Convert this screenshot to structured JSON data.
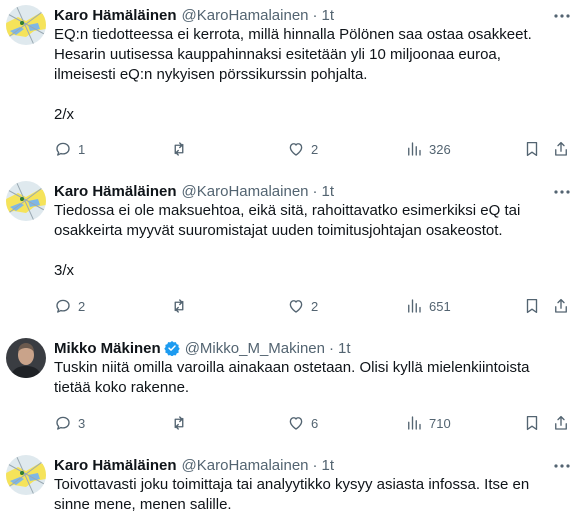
{
  "tweets": [
    {
      "name": "Karo Hämäläinen",
      "handle": "@KaroHamalainen",
      "time": "1t",
      "verified": false,
      "avatar": "map-avatar",
      "lines": [
        "EQ:n tiedotteessa ei kerrota, millä hinnalla Pölönen saa ostaa osakkeet.",
        "Hesarin uutisessa kauppahinnaksi esitetään yli 10 miljoonaa euroa,",
        "ilmeisesti eQ:n nykyisen pörssikurssin pohjalta."
      ],
      "footer": "2/x",
      "replies": "1",
      "retweets": "",
      "likes": "2",
      "views": "326"
    },
    {
      "name": "Karo Hämäläinen",
      "handle": "@KaroHamalainen",
      "time": "1t",
      "verified": false,
      "avatar": "map-avatar",
      "lines": [
        "Tiedossa ei ole maksuehtoa, eikä sitä, rahoittavatko esimerkiksi eQ tai",
        "osakkeirta myyvät suuromistajat uuden toimitusjohtajan osakeostot."
      ],
      "footer": "3/x",
      "replies": "2",
      "retweets": "",
      "likes": "2",
      "views": "651"
    },
    {
      "name": "Mikko Mäkinen",
      "handle": "@Mikko_M_Makinen",
      "time": "1t",
      "verified": true,
      "avatar": "person-avatar",
      "lines": [
        "Tuskin niitä omilla varoilla ainakaan ostetaan. Olisi kyllä mielenkiintoista",
        "tietää koko rakenne."
      ],
      "footer": "",
      "replies": "3",
      "retweets": "",
      "likes": "6",
      "views": "710"
    },
    {
      "name": "Karo Hämäläinen",
      "handle": "@KaroHamalainen",
      "time": "1t",
      "verified": false,
      "avatar": "map-avatar",
      "lines": [
        "Toivottavasti joku toimittaja tai analyytikko kysyy asiasta infossa. Itse en",
        "sinne mene, menen salille."
      ],
      "footer": "",
      "replies": "",
      "retweets": "",
      "likes": "",
      "views": ""
    }
  ],
  "colors": {
    "text": "#0f1419",
    "secondary": "#536471",
    "verified": "#1d9bf0"
  }
}
